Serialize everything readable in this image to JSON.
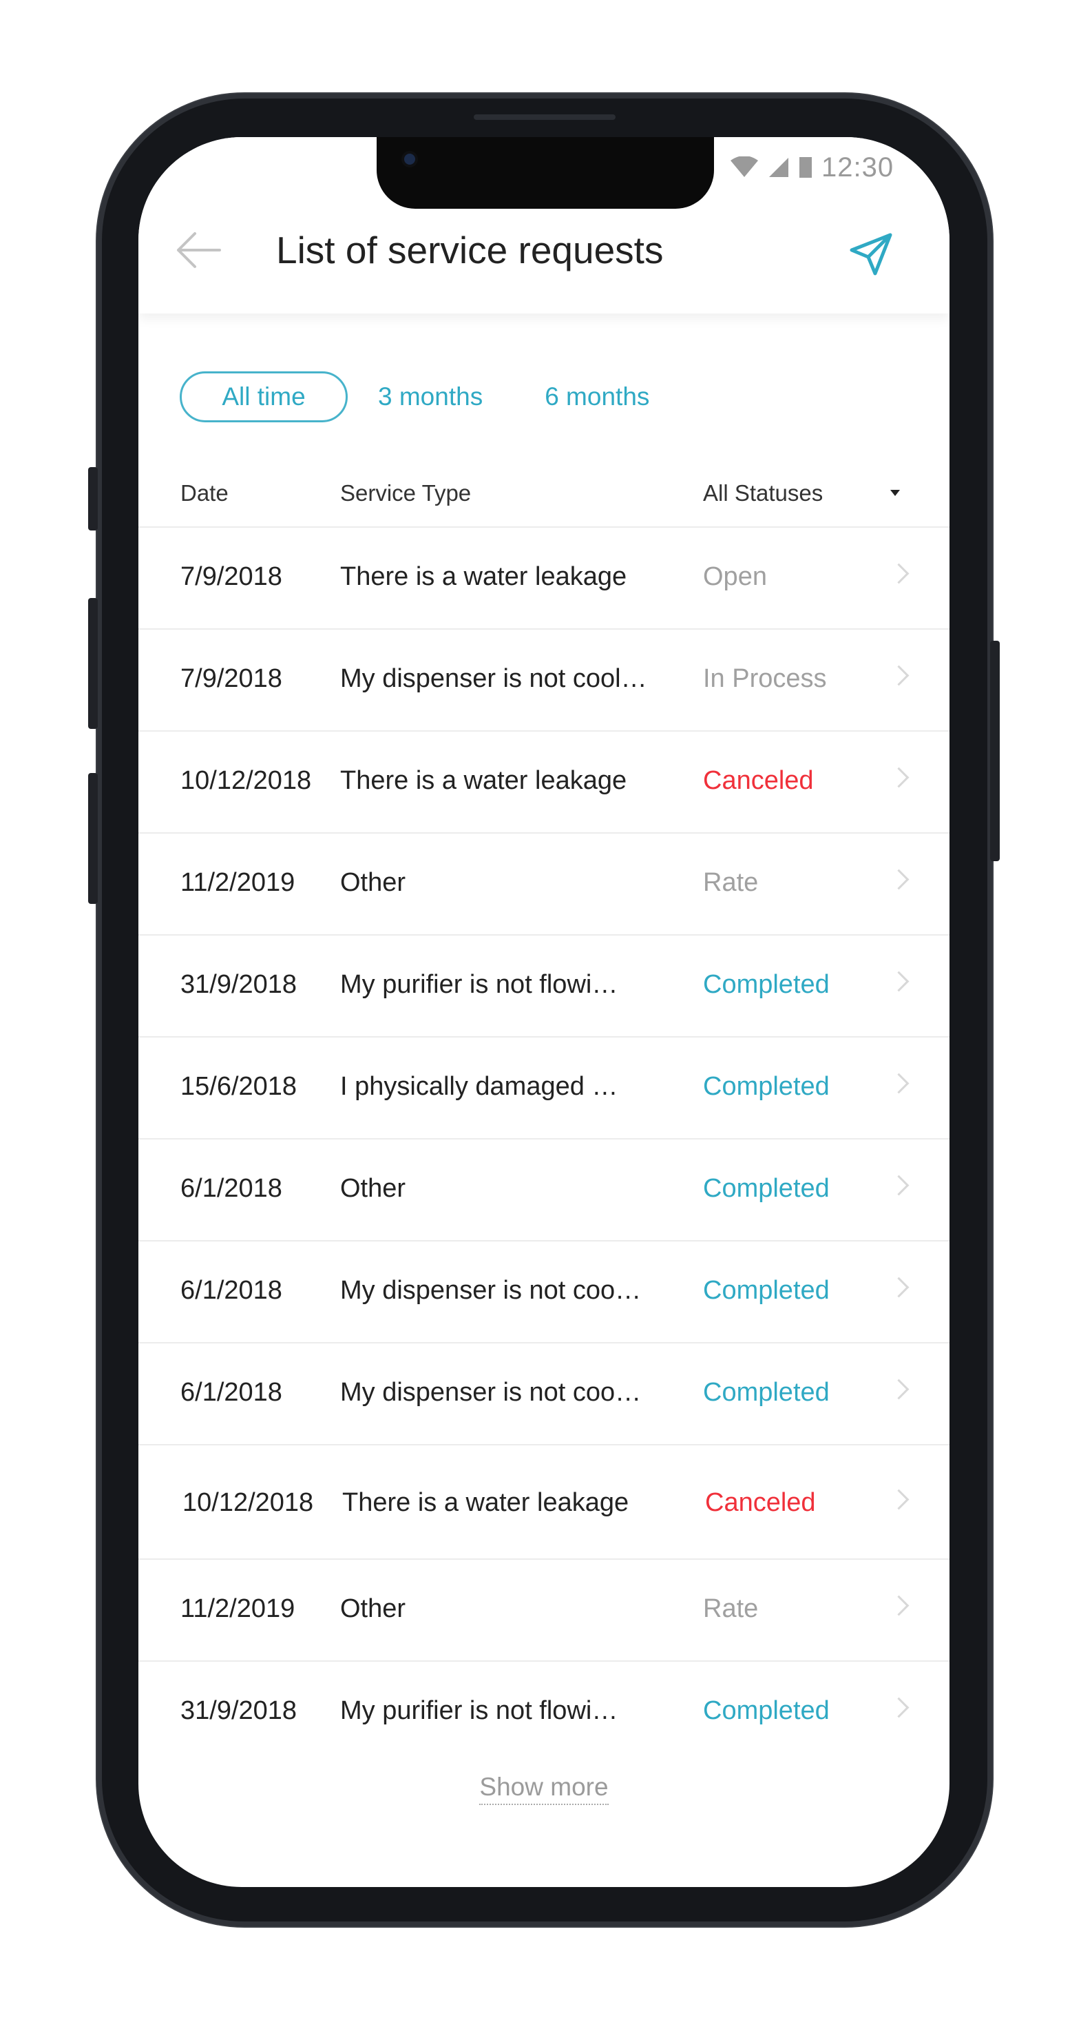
{
  "status_bar": {
    "time": "12:30"
  },
  "header": {
    "title": "List of service requests"
  },
  "filters": [
    {
      "label": "All time",
      "active": true
    },
    {
      "label": "3 months",
      "active": false
    },
    {
      "label": "6 months",
      "active": false
    }
  ],
  "columns": {
    "date": "Date",
    "service_type": "Service Type",
    "status": "All Statuses"
  },
  "rows": [
    {
      "date": "7/9/2018",
      "service_type": "There is a water leakage",
      "status": "Open"
    },
    {
      "date": "7/9/2018",
      "service_type": "My dispenser is not cool…",
      "status": "In Process"
    },
    {
      "date": "10/12/2018",
      "service_type": "There is a water leakage",
      "status": "Canceled"
    },
    {
      "date": "11/2/2019",
      "service_type": "Other",
      "status": "Rate"
    },
    {
      "date": "31/9/2018",
      "service_type": "My purifier is not flowi…",
      "status": "Completed"
    },
    {
      "date": "15/6/2018",
      "service_type": "I physically damaged …",
      "status": "Completed"
    },
    {
      "date": "6/1/2018",
      "service_type": "Other",
      "status": "Completed"
    },
    {
      "date": "6/1/2018",
      "service_type": "My dispenser is not coo…",
      "status": "Completed"
    },
    {
      "date": "6/1/2018",
      "service_type": "My dispenser is not coo…",
      "status": "Completed"
    },
    {
      "date": "10/12/2018",
      "service_type": "There is a water leakage",
      "status": "Canceled"
    },
    {
      "date": "11/2/2019",
      "service_type": "Other",
      "status": "Rate"
    },
    {
      "date": "31/9/2018",
      "service_type": "My purifier is not flowi…",
      "status": "Completed"
    }
  ],
  "show_more": "Show more",
  "colors": {
    "accent": "#2fa9c4",
    "canceled": "#f0303a",
    "completed": "#2fa9c4",
    "muted": "#a0a0a0"
  },
  "icons": {
    "back": "arrow-left-icon",
    "send": "paper-plane-icon",
    "row_chevron": "chevron-right-icon"
  }
}
